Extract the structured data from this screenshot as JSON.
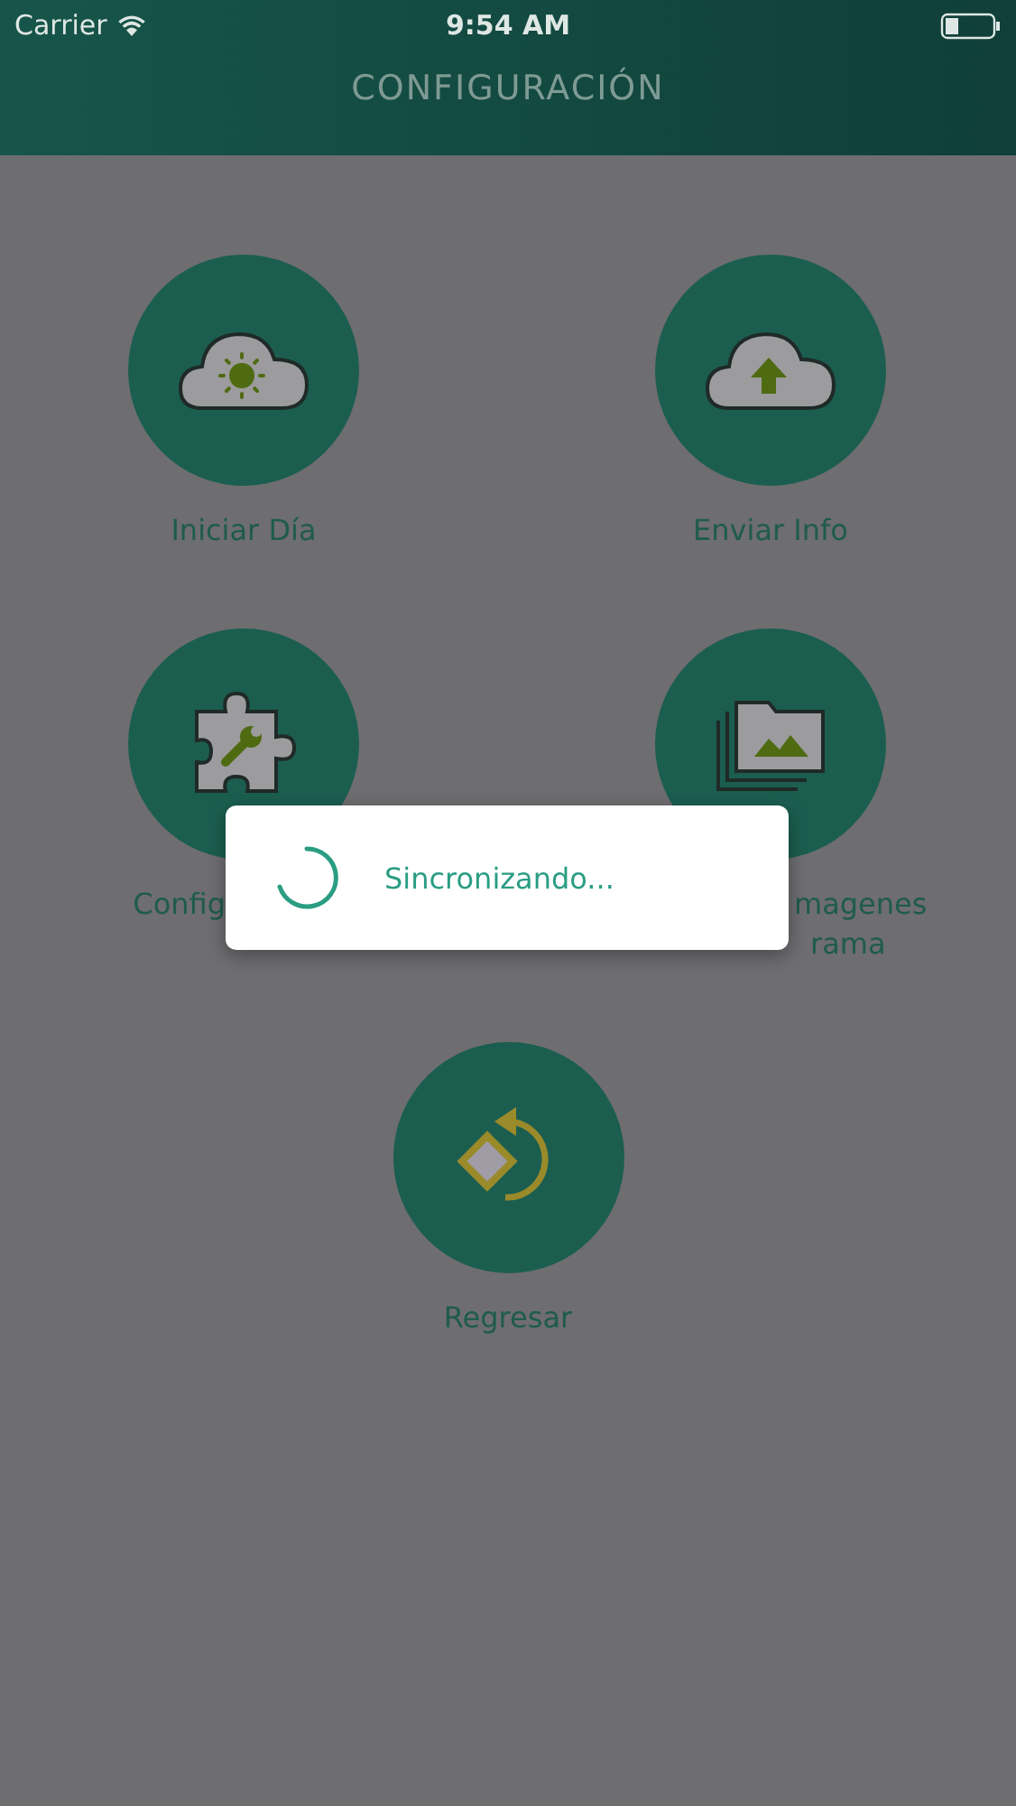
{
  "status_bar": {
    "carrier": "Carrier",
    "time": "9:54 AM"
  },
  "header": {
    "title": "CONFIGURACIÓN"
  },
  "tiles": [
    {
      "lines": [
        "Iniciar Día"
      ]
    },
    {
      "lines": [
        "Enviar Info"
      ]
    },
    {
      "lines": [
        "Config"
      ]
    },
    {
      "lines": [
        "magenes",
        "rama"
      ]
    },
    {
      "lines": [
        "Regresar"
      ]
    }
  ],
  "dialog": {
    "message": "Sincronizando..."
  }
}
